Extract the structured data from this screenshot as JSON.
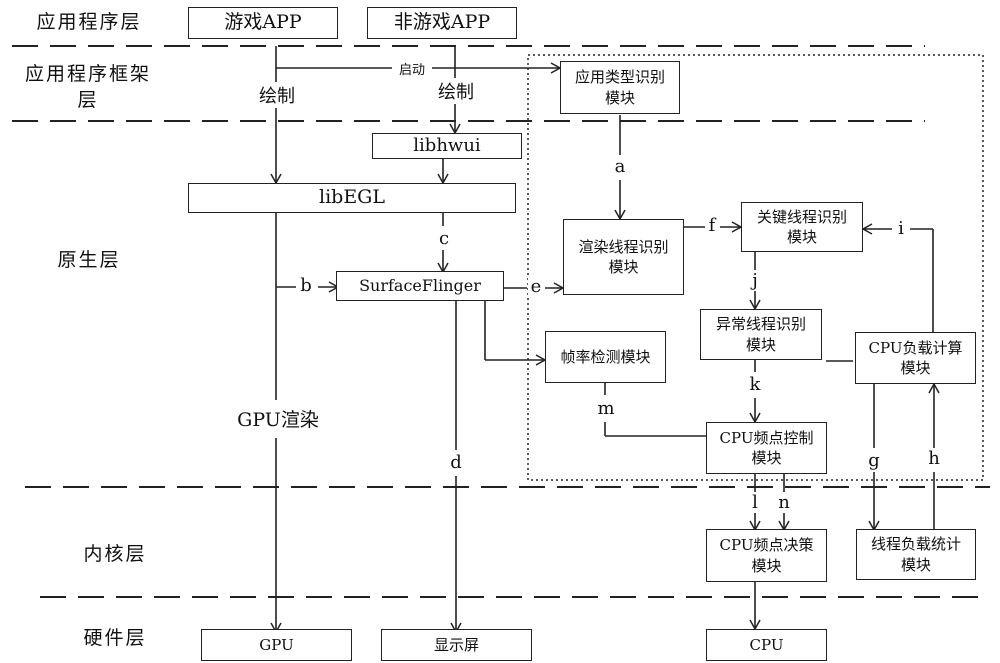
{
  "layers": {
    "app": "应用程序层",
    "framework": "应用程序框架层",
    "native": "原生层",
    "kernel": "内核层",
    "hardware": "硬件层"
  },
  "boxes": {
    "game_app": "游戏APP",
    "non_game_app": "非游戏APP",
    "app_type_id": "应用类型识别模块",
    "libhwui": "libhwui",
    "libegl": "libEGL",
    "surfaceflinger": "SurfaceFlinger",
    "render_thread_id": "渲染线程识别模块",
    "key_thread_id": "关键线程识别模块",
    "abnormal_thread_id": "异常线程识别模块",
    "frame_rate_detect": "帧率检测模块",
    "cpu_load_calc": "CPU负载计算模块",
    "cpu_freq_control": "CPU频点控制模块",
    "cpu_freq_decision": "CPU频点决策模块",
    "thread_load_stats": "线程负载统计模块",
    "gpu": "GPU",
    "display": "显示屏",
    "cpu": "CPU"
  },
  "edge_labels": {
    "launch": "启动",
    "draw_game": "绘制",
    "draw_nongame": "绘制",
    "gpu_render": "GPU渲染",
    "a": "a",
    "b": "b",
    "c": "c",
    "d": "d",
    "e": "e",
    "f": "f",
    "g": "g",
    "h": "h",
    "i": "i",
    "j": "j",
    "k": "k",
    "l": "l",
    "m": "m",
    "n": "n"
  }
}
